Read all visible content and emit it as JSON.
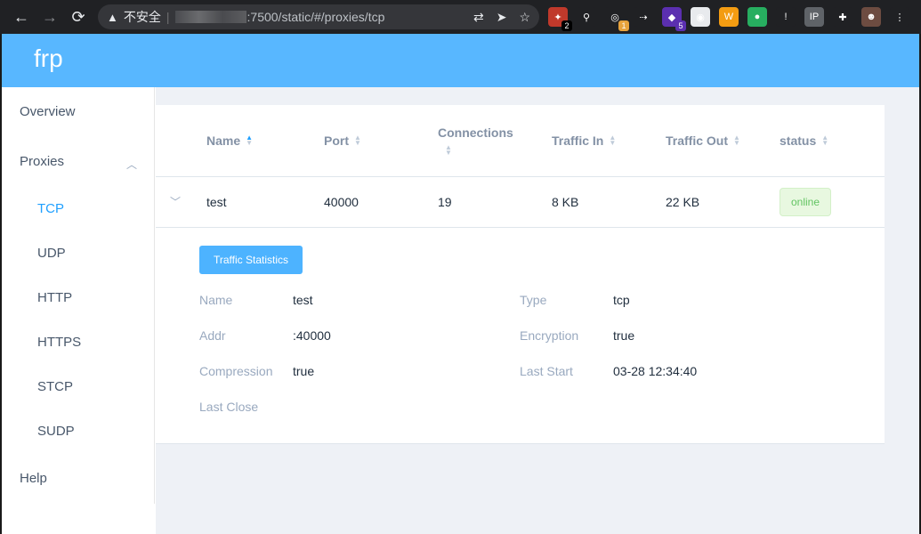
{
  "browser": {
    "back": "←",
    "forward": "→",
    "reload": "⟳",
    "warning_icon": "▲",
    "insecure_label": "不安全",
    "url_host_blurred": "",
    "url_rest": ":7500/static/#/proxies/tcp",
    "translate_icon": "⇄",
    "send_icon": "➤",
    "star_icon": "☆",
    "extensions": [
      {
        "icon": "✦",
        "bg": "#c0392b",
        "badge": "2",
        "badge_bg": "#000"
      },
      {
        "icon": "⚲",
        "bg": "#202124",
        "badge": "",
        "badge_bg": ""
      },
      {
        "icon": "◎",
        "bg": "#202124",
        "badge": "1",
        "badge_bg": "#e8a33d"
      },
      {
        "icon": "⇢",
        "bg": "#202124",
        "badge": "",
        "badge_bg": ""
      },
      {
        "icon": "◆",
        "bg": "#5b2fb0",
        "badge": "5",
        "badge_bg": "#5b2fb0"
      },
      {
        "icon": "◉",
        "bg": "#e8eaed",
        "badge": "",
        "badge_bg": ""
      },
      {
        "icon": "W",
        "bg": "#f39c12",
        "badge": "",
        "badge_bg": ""
      },
      {
        "icon": "●",
        "bg": "#27ae60",
        "badge": "",
        "badge_bg": ""
      },
      {
        "icon": "!",
        "bg": "#202124",
        "badge": "",
        "badge_bg": ""
      },
      {
        "icon": "IP",
        "bg": "#5f6368",
        "badge": "",
        "badge_bg": ""
      },
      {
        "icon": "✚",
        "bg": "#202124",
        "badge": "",
        "badge_bg": ""
      },
      {
        "icon": "☻",
        "bg": "#6d4c41",
        "badge": "",
        "badge_bg": ""
      },
      {
        "icon": "⋮",
        "bg": "#202124",
        "badge": "",
        "badge_bg": ""
      }
    ]
  },
  "app": {
    "brand": "frp"
  },
  "sidebar": {
    "overview": "Overview",
    "proxies": "Proxies",
    "submenu": [
      "TCP",
      "UDP",
      "HTTP",
      "HTTPS",
      "STCP",
      "SUDP"
    ],
    "help": "Help"
  },
  "table": {
    "headers": [
      "Name",
      "Port",
      "Connections",
      "Traffic In",
      "Traffic Out",
      "status"
    ],
    "row": {
      "name": "test",
      "port": "40000",
      "connections": "19",
      "traffic_in": "8 KB",
      "traffic_out": "22 KB",
      "status": "online"
    }
  },
  "details": {
    "button": "Traffic Statistics",
    "labels": {
      "name": "Name",
      "type": "Type",
      "addr": "Addr",
      "encryption": "Encryption",
      "compression": "Compression",
      "last_start": "Last Start",
      "last_close": "Last Close"
    },
    "values": {
      "name": "test",
      "type": "tcp",
      "addr": ":40000",
      "encryption": "true",
      "compression": "true",
      "last_start": "03-28 12:34:40",
      "last_close": ""
    }
  },
  "colors": {
    "header": "#58b7ff",
    "accent": "#20a0ff",
    "online": "#62c462"
  }
}
